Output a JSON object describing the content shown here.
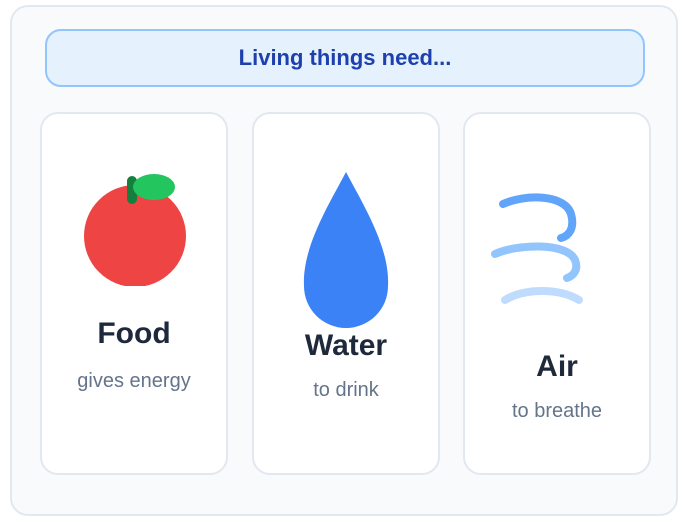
{
  "banner": {
    "title": "Living things need..."
  },
  "cards": [
    {
      "label": "Food",
      "subtitle": "gives energy",
      "icon": "apple-icon"
    },
    {
      "label": "Water",
      "subtitle": "to drink",
      "icon": "water-drop-icon"
    },
    {
      "label": "Air",
      "subtitle": "to breathe",
      "icon": "wind-icon"
    }
  ],
  "colors": {
    "banner_fill": "#e6f1fe",
    "banner_border": "#93c5fd",
    "banner_text": "#1e40af",
    "apple": "#ef4444",
    "leaf": "#22c55e",
    "stem": "#15803d",
    "water": "#3b82f6",
    "wind": [
      "#60a5fa",
      "#93c5fd",
      "#bfdbfe"
    ],
    "label_text": "#1e293b",
    "sub_text": "#64748b"
  }
}
